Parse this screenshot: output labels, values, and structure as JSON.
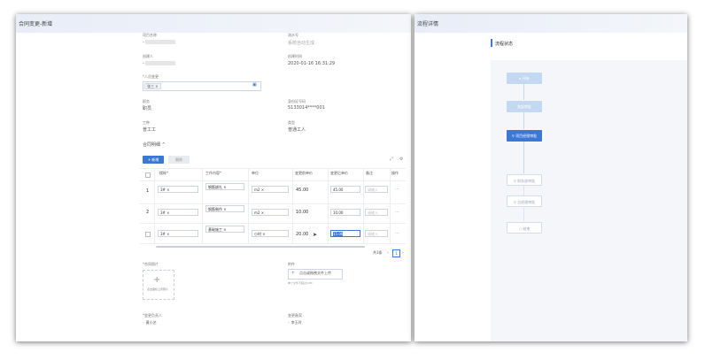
{
  "left_panel": {
    "title": "合同变更-新增",
    "fields": {
      "project_name": {
        "label": "项目名称",
        "value": "-"
      },
      "contract_no": {
        "label": "流水号",
        "value": "系统自动生成"
      },
      "creator": {
        "label": "创建人",
        "value": "-"
      },
      "created_at": {
        "label": "创建时间",
        "value": "2020-01-16 16:31:29"
      },
      "cc": {
        "label": "*人员变更",
        "tag": "张三"
      },
      "position": {
        "label": "职务",
        "value": "职员"
      },
      "id_number": {
        "label": "身份证号码",
        "value": "5133014****001"
      },
      "work_type": {
        "label": "工种",
        "value": "普工工"
      },
      "category": {
        "label": "类型",
        "value": "普通工人"
      },
      "details_label": "合同明细"
    },
    "table": {
      "add_label": "+ 新增",
      "delete_label": "删除",
      "headers": [
        "",
        "楼栋*",
        "工作内容*",
        "单位",
        "变更前单价",
        "变更后单价",
        "备注",
        "操作"
      ],
      "rows": [
        {
          "idx": "1",
          "building": "3#",
          "work": "钢筋绑扎",
          "unit": "m2",
          "before": "45.00",
          "after": "45.00",
          "remark": "请输入"
        },
        {
          "idx": "2",
          "building": "3#",
          "work": "钢筋制作",
          "unit": "m2",
          "before": "10.00",
          "after": "10.00",
          "remark": "请输入"
        },
        {
          "idx": "3",
          "building": "3#",
          "work": "基础施工",
          "unit": "小时",
          "before": "20.00",
          "after": "15.00",
          "remark": "请输入"
        }
      ],
      "total": "共3条",
      "page": "1"
    },
    "attachment": {
      "label": "*合同照片",
      "upload_text": "点击图标上传照片",
      "file_label": "附件",
      "file_button": "点击或拖拽文件上传",
      "file_hint": "单个文件不超过10M"
    },
    "bottom": {
      "left_label": "*变更负责人",
      "left_value": "黄小艺",
      "right_label": "变更备案",
      "right_value": "李玉玲"
    }
  },
  "right_panel": {
    "title": "流程详情",
    "section": "流程状态",
    "steps": [
      {
        "label": "开始",
        "state": "done"
      },
      {
        "label": "发起审批",
        "state": "done"
      },
      {
        "label": "项目经理审批",
        "state": "current"
      },
      {
        "label": "财务部审批",
        "state": "todo"
      },
      {
        "label": "总经理审批",
        "state": "todo"
      },
      {
        "label": "结束",
        "state": "todo"
      }
    ]
  },
  "colors": {
    "accent": "#3a78d4",
    "header_bg": "#e8edf7",
    "done": "#c5d8f1"
  }
}
